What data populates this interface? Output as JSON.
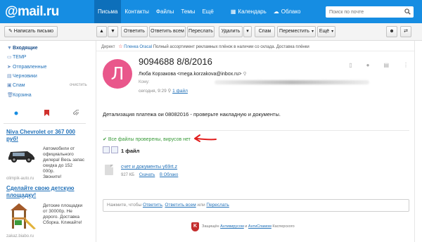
{
  "header": {
    "logo": "@mail.ru",
    "nav": [
      "Письма",
      "Контакты",
      "Файлы",
      "Темы",
      "Ещё"
    ],
    "calendar": "Календарь",
    "cloud": "Облако",
    "search_placeholder": "Поиск по почте"
  },
  "toolbar": {
    "compose": "Написать письмо",
    "reply": "Ответить",
    "reply_all": "Ответить всем",
    "forward": "Переслать",
    "delete": "Удалить",
    "spam": "Спам",
    "move": "Переместить",
    "more": "Ещё"
  },
  "sidebar": {
    "folders": [
      "Входящие",
      "TEMP",
      "Отправленные",
      "Черновики",
      "Спам",
      "Корзина"
    ],
    "clean": "очистить"
  },
  "ads": [
    {
      "title": "Niva Chevrolet от 367 000 руб!",
      "body": [
        "Автомобили от",
        "официального",
        "дилера! Весь запас",
        "скидка до 152 000р.",
        "Звоните!"
      ],
      "url": "olimpik-auto.ru"
    },
    {
      "title": "Сделайте свою детскую площадку!",
      "body": [
        "Детские площадки",
        "от 30000р. Не",
        "дорого. Доставка",
        "Сборка. Кликайте!"
      ],
      "url": "zakaz.biabo.ru"
    }
  ],
  "message": {
    "ad_tag": "Директ",
    "ad_link": "Пленка Oracal",
    "ad_text": "Полный ассортимент рекламных плёнок в наличии со склада. Доставка плёнки",
    "avatar_letter": "Л",
    "subject": "9094688 8/8/2016",
    "from": "Люба Корзакова <mega.korzakova@inbox.ru>",
    "to_label": "Кому:",
    "date": "сегодня, 9:29",
    "files_link": "1 файл",
    "body": "Детализация платежа ои 08082016 - проверьте накладную и документы.",
    "verified": "Все файлы проверены, вирусов нет",
    "files_count": "1 файл",
    "file_name": "счет и документы у69rt.z",
    "file_size": "927 КБ",
    "download": "Скачать",
    "to_cloud": "В Облако",
    "reply_prefix": "Нажмите, чтобы ",
    "reply_link1": "Ответить",
    "reply_link2": "Ответить всем",
    "reply_or": " или ",
    "reply_link3": "Переслать",
    "footer_prefix": "Защищён ",
    "footer_link1": "Антивирусом",
    "footer_mid": " и ",
    "footer_link2": "АнтиСпамом",
    "footer_suffix": " Касперского"
  },
  "colors": {
    "topbar": "#168de2",
    "avatar": "#e9578b",
    "verified": "#3a9b3a",
    "arrow": "#e11d1d"
  }
}
